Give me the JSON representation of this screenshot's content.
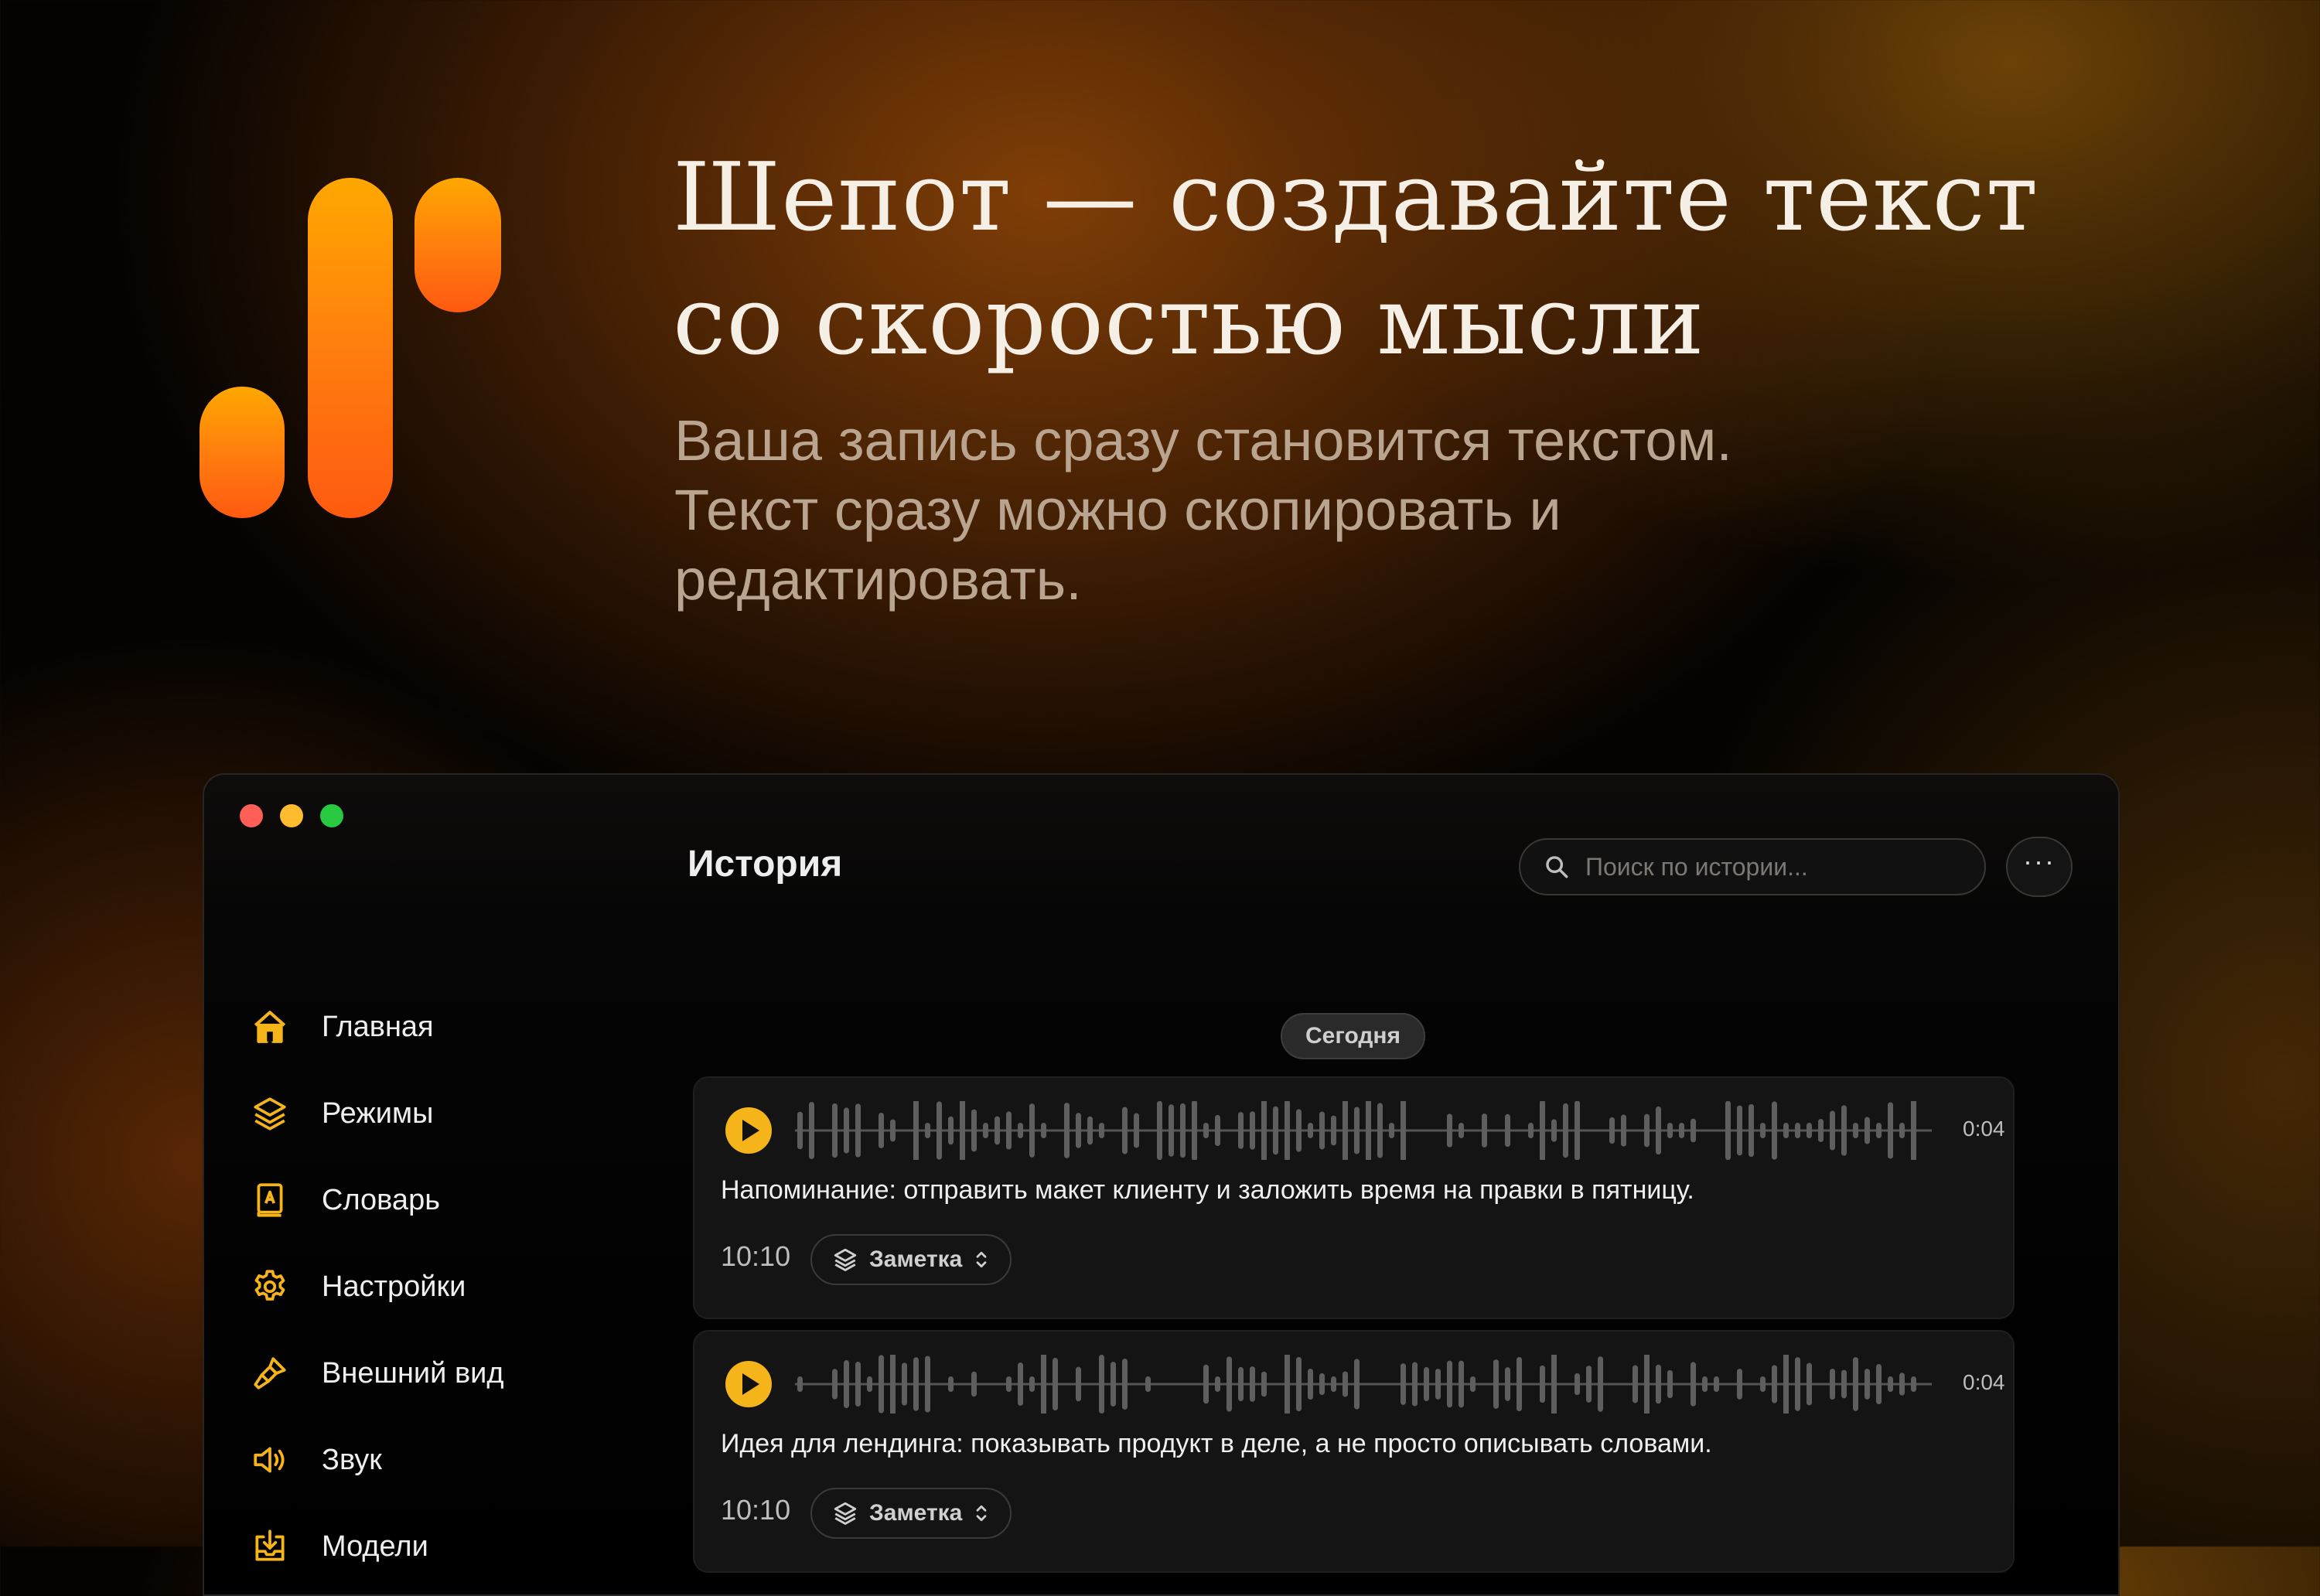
{
  "hero": {
    "title_line1": "Шепот — создавайте текст",
    "title_line2": "со скоростью мысли",
    "subtitle_line1": "Ваша запись сразу становится текстом.",
    "subtitle_line2": "Текст сразу можно скопировать и",
    "subtitle_line3": "редактировать."
  },
  "colors": {
    "accent": "#f4b41a",
    "logo_top": "#ffa800",
    "logo_bottom": "#ff5a10",
    "window_bg": "#000000",
    "card_bg": "#141414"
  },
  "window": {
    "page_title": "История",
    "search": {
      "placeholder": "Поиск по истории..."
    },
    "more_label": "···"
  },
  "sidebar": {
    "items": [
      {
        "label": "Главная",
        "icon": "home-icon"
      },
      {
        "label": "Режимы",
        "icon": "layers-icon"
      },
      {
        "label": "Словарь",
        "icon": "dictionary-icon"
      },
      {
        "label": "Настройки",
        "icon": "gear-icon"
      },
      {
        "label": "Внешний вид",
        "icon": "brush-icon"
      },
      {
        "label": "Звук",
        "icon": "speaker-icon"
      },
      {
        "label": "Модели",
        "icon": "download-icon"
      }
    ]
  },
  "history": {
    "date_label": "Сегодня",
    "entries": [
      {
        "duration": "0:04",
        "text": "Напоминание: отправить макет клиенту и заложить время на правки в пятницу.",
        "time": "10:10",
        "mode": "Заметка"
      },
      {
        "duration": "0:04",
        "text": "Идея для лендинга: показывать продукт в деле, а не просто описывать словами.",
        "time": "10:10",
        "mode": "Заметка"
      }
    ]
  }
}
